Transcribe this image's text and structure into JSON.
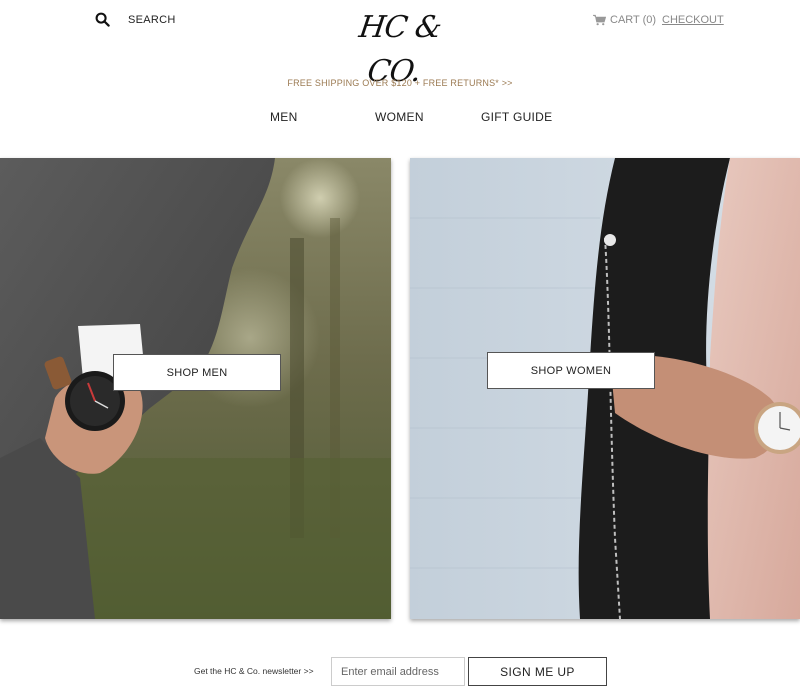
{
  "header": {
    "search_label": "SEARCH",
    "search_icon": "search-icon",
    "logo_text": "HC & CO.",
    "cart_label": "CART (0)",
    "cart_icon": "cart-icon",
    "checkout_label": "CHECKOUT"
  },
  "promo": {
    "text": "FREE SHIPPING OVER $120  +  FREE RETURNS* >>"
  },
  "nav": {
    "items": [
      {
        "label": "MEN"
      },
      {
        "label": "WOMEN"
      },
      {
        "label": "GIFT GUIDE"
      }
    ]
  },
  "panels": {
    "men_button": "SHOP MEN",
    "women_button": "SHOP WOMEN"
  },
  "newsletter": {
    "text": "Get the HC & Co. newsletter >>",
    "placeholder": "Enter email address",
    "button": "SIGN ME UP"
  },
  "colors": {
    "promo": "#9b7a52",
    "muted": "#888888"
  }
}
